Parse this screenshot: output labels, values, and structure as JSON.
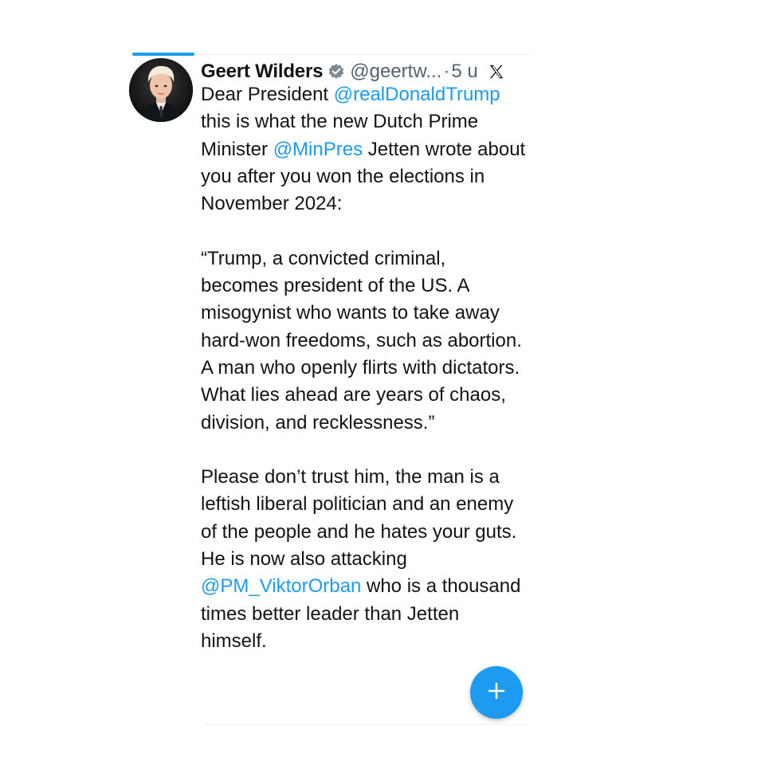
{
  "tweet": {
    "author_name": "Geert Wilders",
    "handle": "@geertw...",
    "separator": "·",
    "time": "5 u",
    "verified_icon": "verified-badge-icon",
    "platform_icon": "x-logo-icon",
    "paragraphs": [
      [
        {
          "type": "text",
          "value": "Dear President "
        },
        {
          "type": "mention",
          "value": "@realDonaldTrump"
        },
        {
          "type": "text",
          "value": " this is what the new Dutch Prime Minister "
        },
        {
          "type": "mention",
          "value": "@MinPres"
        },
        {
          "type": "text",
          "value": " Jetten wrote about you after you won the elections in November 2024:"
        }
      ],
      [
        {
          "type": "text",
          "value": "“Trump, a convicted criminal, becomes president of the US. A misogynist who wants to take away hard-won freedoms, such as abortion. A man who openly flirts with dictators. What lies ahead are years of chaos, division, and recklessness.”"
        }
      ],
      [
        {
          "type": "text",
          "value": "Please don’t trust him, the man is a leftish liberal politician and an enemy of the people and he hates your guts. He is now also attacking "
        },
        {
          "type": "mention",
          "value": "@PM_ViktorOrban"
        },
        {
          "type": "text",
          "value": " who is a thousand times better leader than Jetten himself."
        }
      ]
    ]
  },
  "compose_button": {
    "icon": "plus-icon",
    "label": "+"
  },
  "colors": {
    "accent": "#1d9bf0",
    "text": "#0f1419",
    "muted": "#536471"
  }
}
